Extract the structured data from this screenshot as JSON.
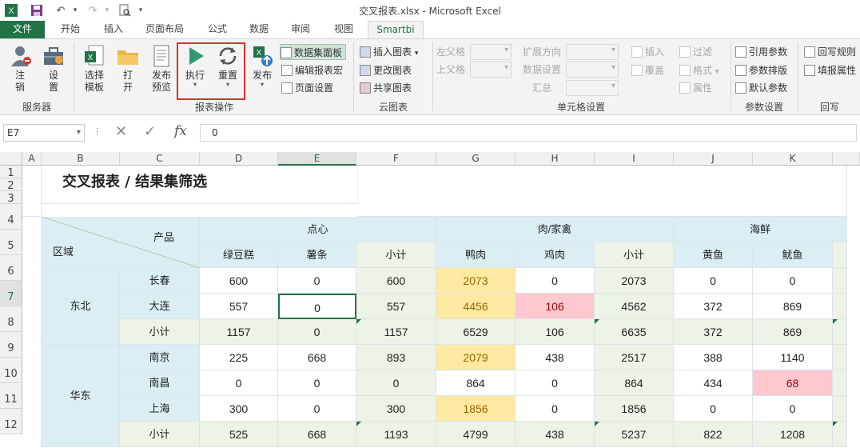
{
  "window": {
    "title": "交叉报表.xlsx - Microsoft Excel"
  },
  "tabs": [
    "文件",
    "开始",
    "插入",
    "页面布局",
    "公式",
    "数据",
    "审阅",
    "视图",
    "Smartbi"
  ],
  "ribbon": {
    "server": {
      "login": "注销",
      "settings": "设置",
      "group": "服务器"
    },
    "report_ops": {
      "select_template": "选择模板",
      "open": "打开",
      "publish_preview": "发布预览",
      "execute": "执行",
      "reset": "重置",
      "publish": "发布",
      "dataset_panel": "数据集面板",
      "edit_macro": "编辑报表宏",
      "page_setup": "页面设置",
      "group": "报表操作"
    },
    "cloud_chart": {
      "insert_chart": "插入图表",
      "change_chart": "更改图表",
      "share_chart": "共享图表",
      "group": "云图表"
    },
    "cell_settings": {
      "left_parent": "左父格",
      "top_parent": "上父格",
      "expand_dir": "扩展方向",
      "data_settings": "数据设置",
      "summary": "汇总",
      "insert": "插入",
      "overwrite": "覆盖",
      "filter": "过滤",
      "format": "格式",
      "attribute": "属性",
      "group": "单元格设置"
    },
    "params": {
      "ref_param": "引用参数",
      "param_layout": "参数排版",
      "default_param": "默认参数",
      "group": "参数设置"
    },
    "writeback": {
      "rule": "回写规则",
      "fill_attr": "填报属性",
      "group": "回写"
    }
  },
  "formula_bar": {
    "cell_ref": "E7",
    "value": "0"
  },
  "columns": [
    "A",
    "B",
    "C",
    "D",
    "E",
    "F",
    "G",
    "H",
    "I",
    "J",
    "K"
  ],
  "rows": [
    "1",
    "2",
    "3",
    "4",
    "5",
    "6",
    "7",
    "8",
    "9",
    "10",
    "11",
    "12"
  ],
  "sheet": {
    "title": "交叉报表 / 结果集筛选",
    "corner_product": "产品",
    "corner_region": "区域",
    "groups": [
      "点心",
      "肉/家禽",
      "海鲜"
    ],
    "products": [
      "绿豆糕",
      "薯条",
      "小计",
      "鸭肉",
      "鸡肉",
      "小计",
      "黄鱼",
      "鱿鱼"
    ],
    "regions": [
      {
        "name": "东北",
        "cities": [
          {
            "name": "长春",
            "values": [
              "600",
              "0",
              "600",
              "2073",
              "0",
              "2073",
              "0",
              "0"
            ]
          },
          {
            "name": "大连",
            "values": [
              "557",
              "0",
              "557",
              "4456",
              "106",
              "4562",
              "372",
              "869"
            ]
          },
          {
            "name": "小计",
            "values": [
              "1157",
              "0",
              "1157",
              "6529",
              "106",
              "6635",
              "372",
              "869"
            ]
          }
        ]
      },
      {
        "name": "华东",
        "cities": [
          {
            "name": "南京",
            "values": [
              "225",
              "668",
              "893",
              "2079",
              "438",
              "2517",
              "388",
              "1140"
            ]
          },
          {
            "name": "南昌",
            "values": [
              "0",
              "0",
              "0",
              "864",
              "0",
              "864",
              "434",
              "68"
            ]
          },
          {
            "name": "上海",
            "values": [
              "300",
              "0",
              "300",
              "1856",
              "0",
              "1856",
              "0",
              "0"
            ]
          },
          {
            "name": "小计",
            "values": [
              "525",
              "668",
              "1193",
              "4799",
              "438",
              "5237",
              "822",
              "1208"
            ]
          }
        ]
      }
    ]
  }
}
